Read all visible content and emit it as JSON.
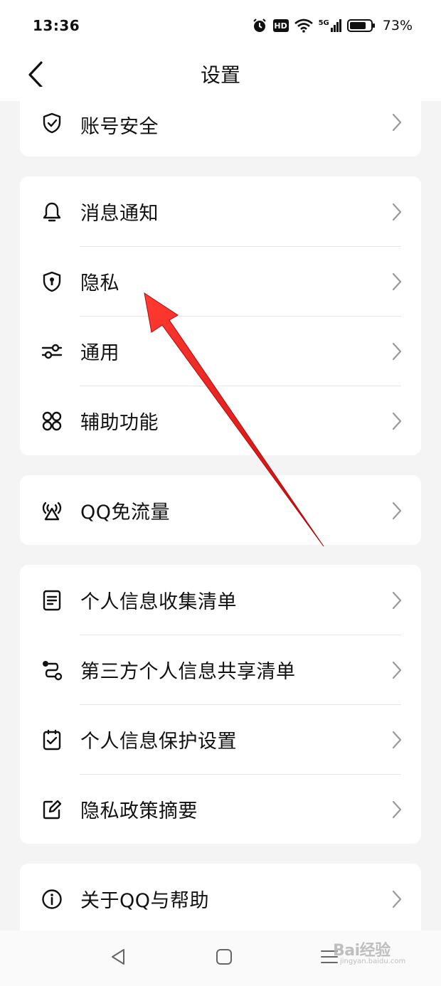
{
  "status_bar": {
    "time": "13:36",
    "battery_percent": "73%",
    "network": "5G",
    "hd_badge": "HD",
    "icons": [
      "alarm-icon",
      "hd-icon",
      "wifi-icon",
      "cellular-5g-icon",
      "battery-icon"
    ]
  },
  "header": {
    "title": "设置",
    "back_icon": "back-chevron-icon"
  },
  "groups": [
    {
      "items": [
        {
          "label": "账号安全",
          "icon": "shield-check-icon"
        }
      ]
    },
    {
      "items": [
        {
          "label": "消息通知",
          "icon": "bell-icon"
        },
        {
          "label": "隐私",
          "icon": "shield-lock-icon"
        },
        {
          "label": "通用",
          "icon": "sliders-icon"
        },
        {
          "label": "辅助功能",
          "icon": "apps-grid-icon"
        }
      ]
    },
    {
      "items": [
        {
          "label": "QQ免流量",
          "icon": "broadcast-tower-icon"
        }
      ]
    },
    {
      "items": [
        {
          "label": "个人信息收集清单",
          "icon": "document-list-icon"
        },
        {
          "label": "第三方个人信息共享清单",
          "icon": "share-flow-icon"
        },
        {
          "label": "个人信息保护设置",
          "icon": "checkbox-doc-icon"
        },
        {
          "label": "隐私政策摘要",
          "icon": "edit-note-icon"
        }
      ]
    },
    {
      "items": [
        {
          "label": "关于QQ与帮助",
          "icon": "info-circle-icon"
        }
      ]
    }
  ],
  "bottom_nav": {
    "icons": [
      "nav-back-icon",
      "nav-home-icon",
      "nav-menu-icon"
    ]
  },
  "watermark": {
    "text": "Bai经验",
    "sub": "jingyan.baidu.com"
  },
  "colors": {
    "arrow": "#e8161b",
    "background": "#f4f4f4",
    "card": "#ffffff"
  }
}
